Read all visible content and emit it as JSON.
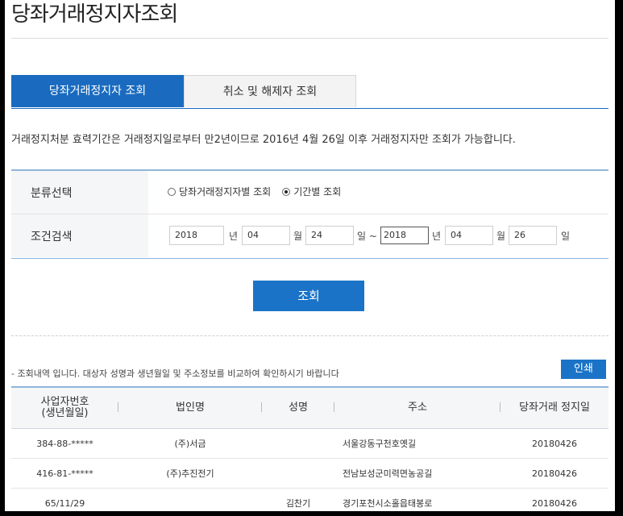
{
  "page": {
    "title": "당좌거래정지자조회"
  },
  "tabs": [
    {
      "label": "당좌거래정지자 조회",
      "active": true
    },
    {
      "label": "취소 및 해제자 조회",
      "active": false
    }
  ],
  "notice": "거래정지처분 효력기간은 거래정지일로부터 만2년이므로 2016년 4월 26일 이후 거래정지자만 조회가 가능합니다.",
  "search": {
    "category_label": "분류선택",
    "radio_options": [
      {
        "label": "당좌거래정지자별 조회",
        "checked": false
      },
      {
        "label": "기간별 조회",
        "checked": true
      }
    ],
    "condition_label": "조건검색",
    "from": {
      "year": "2018",
      "month": "04",
      "day": "24"
    },
    "to": {
      "year": "2018",
      "month": "04",
      "day": "26"
    },
    "unit_year": "년",
    "unit_month": "월",
    "unit_day": "일",
    "unit_day_range": "일 ~",
    "search_button": "조회"
  },
  "results": {
    "note": "- 조회내역 입니다. 대상자 성명과 생년월일 및 주소정보를 비교하여 확인하시기 바랍니다",
    "print_button": "인쇄",
    "columns": {
      "bizno_line1": "사업자번호",
      "bizno_line2": "(생년월일)",
      "corp": "법인명",
      "name": "성명",
      "address": "주소",
      "date": "당좌거래 정지일"
    },
    "rows": [
      {
        "bizno": "384-88-*****",
        "corp": "(주)서금",
        "name": "",
        "address": "서울강동구천호옛길",
        "date": "20180426"
      },
      {
        "bizno": "416-81-*****",
        "corp": "(주)추진전기",
        "name": "",
        "address": "전남보성군미력면농공길",
        "date": "20180426"
      },
      {
        "bizno": "65/11/29",
        "corp": "",
        "name": "김찬기",
        "address": "경기포천시소홀읍태봉로",
        "date": "20180426"
      }
    ]
  },
  "colors": {
    "accent": "#1a6bbf",
    "button": "#1a73c7"
  }
}
